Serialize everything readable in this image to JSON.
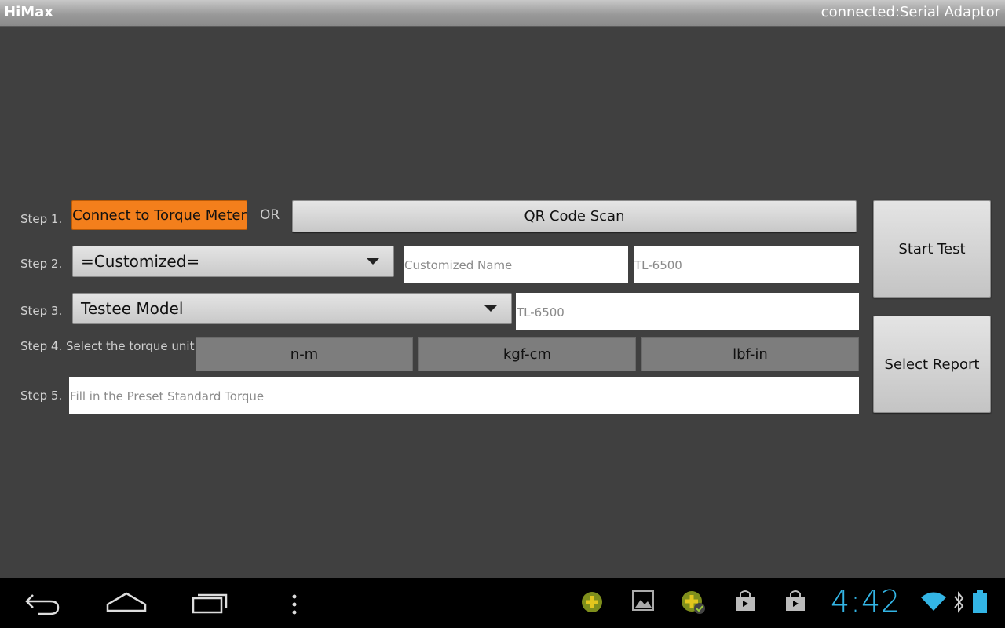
{
  "titlebar": {
    "app_name": "HiMax",
    "connection_status": "connected:Serial Adaptor"
  },
  "steps": {
    "step1_label": "Step 1.",
    "step2_label": "Step 2.",
    "step3_label": "Step 3.",
    "step4_label": "Step 4. Select the torque unit",
    "step5_label": "Step 5."
  },
  "step1": {
    "connect_button": "Connect to Torque Meter",
    "or_text": "OR",
    "qr_button": "QR Code Scan"
  },
  "step2": {
    "selected_option": "=Customized=",
    "name_value": "",
    "name_placeholder": "Customized Name",
    "model_value": "",
    "model_placeholder": "TL-6500"
  },
  "step3": {
    "selected_option": "Testee Model",
    "model_value": "",
    "model_placeholder": "TL-6500"
  },
  "step4": {
    "units": [
      "n-m",
      "kgf-cm",
      "lbf-in"
    ]
  },
  "step5": {
    "torque_value": "",
    "torque_placeholder": "Fill in the Preset Standard Torque"
  },
  "side": {
    "start_test": "Start Test",
    "select_report": "Select Report"
  },
  "system_bar": {
    "clock": "4:42",
    "accent_color": "#33b5e5"
  },
  "icons": [
    "back-icon",
    "home-icon",
    "recent-apps-icon",
    "menu-icon",
    "app-icon",
    "gallery-icon",
    "app-update-icon",
    "store-bag-icon",
    "store-bag-icon",
    "wifi-icon",
    "bluetooth-icon",
    "battery-icon"
  ]
}
